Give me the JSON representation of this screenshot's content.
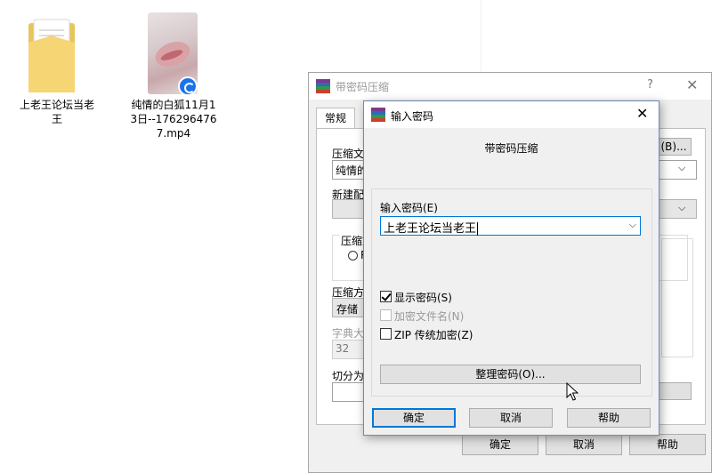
{
  "desktop": {
    "folder_label": "上老王论坛当老王",
    "video_label": "纯情的白狐11月13日--1762964767.mp4"
  },
  "back_window": {
    "title": "带密码压缩",
    "help_glyph": "?",
    "close_glyph": "✕",
    "tab_general": "常规",
    "archive_name_label": "压缩文",
    "archive_name_value": "纯情的",
    "browse_button": "(B)...",
    "new_profile_label": "新建配",
    "format_group_label": "压缩文",
    "radio_partial": "R",
    "method_label": "压缩方",
    "method_value": "存储",
    "dict_label": "字典大",
    "dict_value": "32",
    "split_label": "切分为",
    "ok_button": "确定",
    "cancel_button": "取消",
    "help_button": "帮助"
  },
  "dialog": {
    "title": "输入密码",
    "close_glyph": "✕",
    "subtitle": "带密码压缩",
    "password_label": "输入密码(E)",
    "password_value": "上老王论坛当老王",
    "show_password": "显示密码(S)",
    "encrypt_filenames": "加密文件名(N)",
    "zip_legacy": "ZIP 传统加密(Z)",
    "organize_button": "整理密码(O)...",
    "ok_button": "确定",
    "cancel_button": "取消",
    "help_button": "帮助",
    "dropdown_glyph": "⌵"
  },
  "colors": {
    "accent": "#0078d7",
    "dialog_bg": "#f0f0f0"
  }
}
